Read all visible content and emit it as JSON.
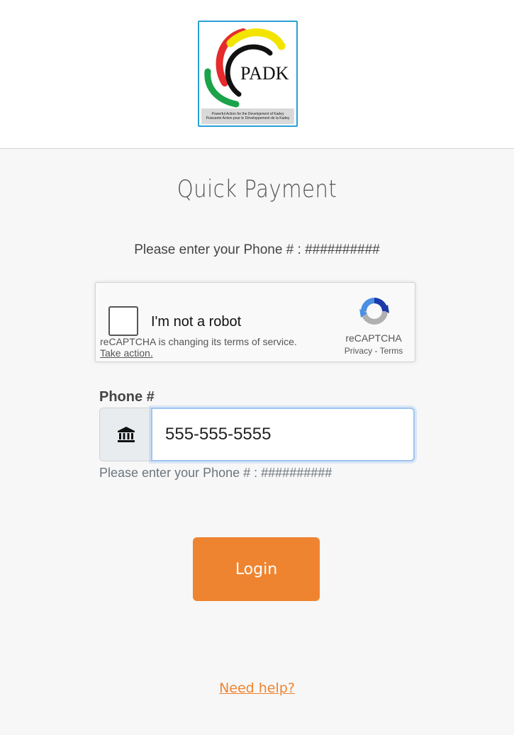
{
  "header": {
    "logo_text": "PADK",
    "logo_tagline_en": "Powerful Action for the Development of Kadey",
    "logo_tagline_fr": "Puissante Action pour le Développement de la Kadey"
  },
  "page": {
    "title": "Quick Payment",
    "instruction": "Please enter your Phone # : ##########"
  },
  "recaptcha": {
    "checkbox_label": "I'm not a robot",
    "notice": "reCAPTCHA is changing its terms of service.",
    "action": "Take action.",
    "brand": "reCAPTCHA",
    "privacy": "Privacy",
    "separator": "-",
    "terms": "Terms",
    "colors": {
      "blue": "#4a90e2",
      "dark_blue": "#1c3aa9",
      "grey": "#b0b0b0"
    }
  },
  "form": {
    "phone_label": "Phone #",
    "phone_value": "555-555-5555",
    "addon_icon": "bank-icon",
    "help_text": "Please enter your Phone # : ##########",
    "login_label": "Login"
  },
  "footer": {
    "need_help": "Need help?"
  },
  "colors": {
    "accent": "#ef8430",
    "background": "#f7f7f7",
    "logo_border": "#2a9fd6"
  }
}
